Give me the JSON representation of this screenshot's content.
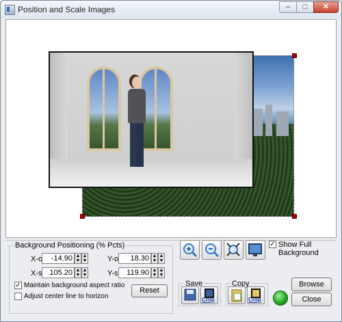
{
  "window": {
    "title": "Position and Scale  Images",
    "controls": {
      "minimize": "–",
      "maximize": "□",
      "close": "✕"
    }
  },
  "canvas": {
    "icons": {
      "handle": "red-square-handle"
    }
  },
  "bg_positioning": {
    "group_label": "Background Positioning (% Pcts)",
    "xoff": {
      "label": "X-off",
      "value": "-14.90"
    },
    "yoff": {
      "label": "Y-off",
      "value": "18.30"
    },
    "xscl": {
      "label": "X-scl",
      "value": "105.20"
    },
    "yscl": {
      "label": "Y-scl",
      "value": "119.90"
    },
    "maintain_aspect": {
      "label": "Maintain background aspect ratio",
      "checked": true
    },
    "adjust_center": {
      "label": "Adjust center line to horizon",
      "checked": false
    },
    "reset_label": "Reset"
  },
  "toolbar": {
    "zoom_in_icon": "zoom-in-icon",
    "zoom_out_icon": "zoom-out-icon",
    "fit_icon": "fit-to-window-icon",
    "monitor_icon": "monitor-icon",
    "show_full_background": {
      "label": "Show Full Background",
      "checked": true
    }
  },
  "save": {
    "label": "Save",
    "crop_label": "Crop"
  },
  "copy": {
    "label": "Copy",
    "crop_label": "Crop"
  },
  "actions": {
    "browse_label": "Browse",
    "close_label": "Close"
  }
}
